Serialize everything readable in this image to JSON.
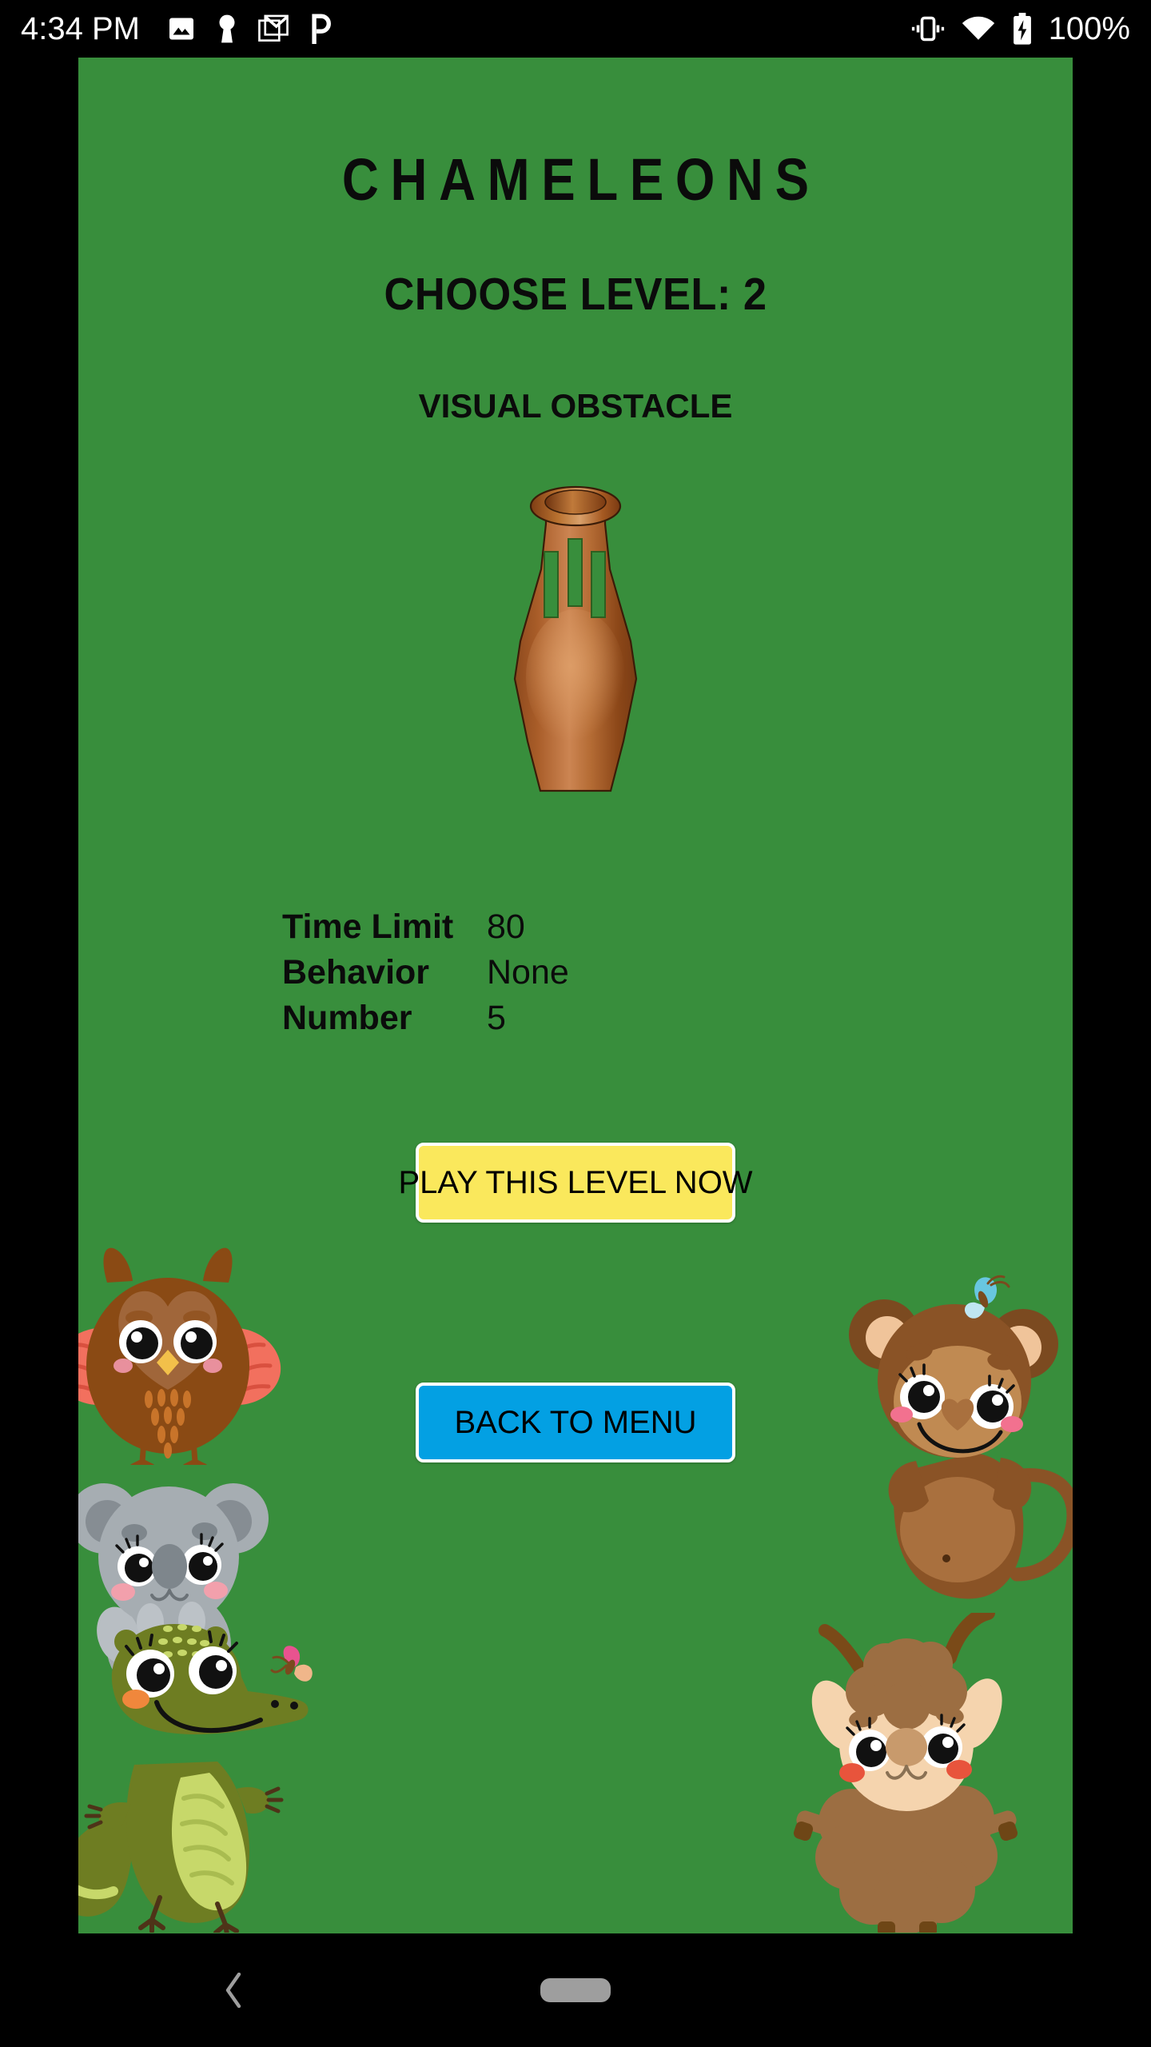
{
  "status_bar": {
    "clock": "4:34 PM",
    "battery_percent": "100%",
    "left_icons": [
      "image-icon",
      "keyhole-icon",
      "gmail-icon",
      "p-app-icon"
    ],
    "right_icons": [
      "vibrate-icon",
      "wifi-icon",
      "battery-charging-icon"
    ]
  },
  "app": {
    "background_color": "#388E3C",
    "title": "CHAMELEONS",
    "level_heading": "CHOOSE LEVEL: 2",
    "obstacle_type": "VISUAL OBSTACLE",
    "obstacle_image": "amphora-vase-icon",
    "stats": [
      {
        "label": "Time Limit",
        "value": "80"
      },
      {
        "label": "Behavior",
        "value": "None"
      },
      {
        "label": "Number",
        "value": "5"
      }
    ],
    "buttons": {
      "play": {
        "label": "PLAY THIS LEVEL NOW",
        "color": "#FAE85C"
      },
      "back": {
        "label": "BACK TO MENU",
        "color": "#03A0E3"
      }
    },
    "decorations": [
      "owl-illustration",
      "koala-illustration",
      "crocodile-illustration",
      "monkey-illustration",
      "alpaca-illustration"
    ]
  },
  "nav_bar": {
    "back_label": "back-chevron",
    "home_label": "home-pill"
  }
}
